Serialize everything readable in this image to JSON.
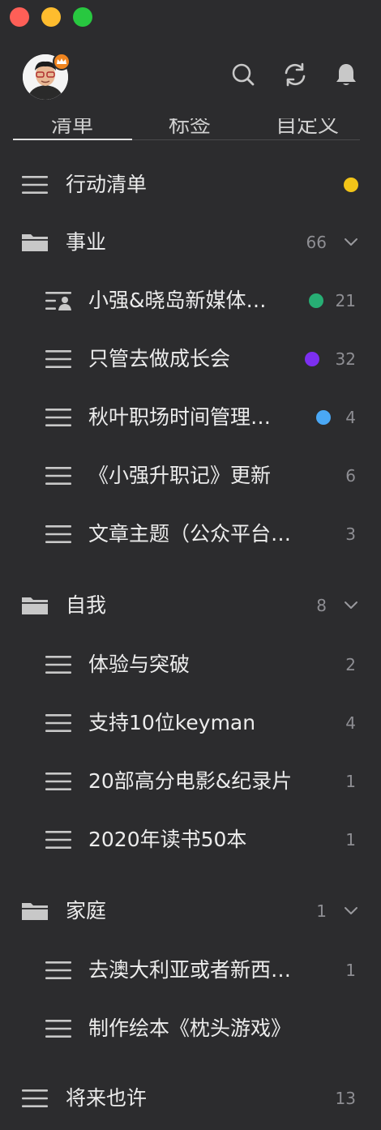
{
  "tabs": [
    {
      "label": "清单"
    },
    {
      "label": "标签"
    },
    {
      "label": "自定义"
    }
  ],
  "lists": {
    "action": {
      "label": "行动清单",
      "dot": "#f2c418"
    },
    "career": {
      "label": "事业",
      "count": "66"
    },
    "career_items": [
      {
        "label": "小强&晓岛新媒体…",
        "count": "21",
        "dot": "#27ae74"
      },
      {
        "label": "只管去做成长会",
        "count": "32",
        "dot": "#7c2ff0"
      },
      {
        "label": "秋叶职场时间管理…",
        "count": "4",
        "dot": "#4aa8f5"
      },
      {
        "label": "《小强升职记》更新",
        "count": "6"
      },
      {
        "label": "文章主题（公众平台…",
        "count": "3"
      }
    ],
    "self": {
      "label": "自我",
      "count": "8"
    },
    "self_items": [
      {
        "label": "体验与突破",
        "count": "2"
      },
      {
        "label": "支持10位keyman",
        "count": "4"
      },
      {
        "label": "20部高分电影&纪录片",
        "count": "1"
      },
      {
        "label": "2020年读书50本",
        "count": "1"
      }
    ],
    "family": {
      "label": "家庭",
      "count": "1"
    },
    "family_items": [
      {
        "label": "去澳大利亚或者新西…",
        "count": "1"
      },
      {
        "label": "制作绘本《枕头游戏》",
        "count": ""
      }
    ],
    "someday": {
      "label": "将来也许",
      "count": "13"
    }
  },
  "icons": {
    "search": "search-icon",
    "sync": "sync-icon",
    "bell": "bell-icon",
    "list": "list-icon",
    "folder": "folder-icon",
    "shared_list": "shared-list-icon",
    "chevron": "chevron-down-icon"
  },
  "colors": {
    "background": "#2c2c2e",
    "text": "#ececec",
    "muted": "#8e8e93"
  }
}
